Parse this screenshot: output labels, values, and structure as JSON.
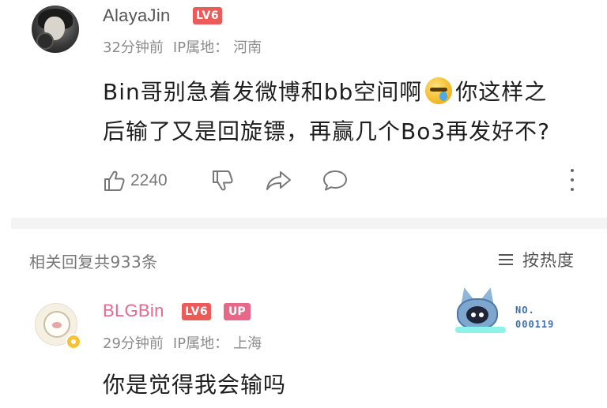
{
  "comment": {
    "username": "AlayaJin",
    "level": "LV6",
    "time": "32分钟前",
    "ip_label": "IP属地：",
    "ip_location": "河南",
    "text_line1_before_emoji": "Bin哥别急着发微博和bb空间啊",
    "text_line1_after_emoji": "你这样之",
    "text_line2": "后输了又是回旋镖，再赢几个Bo3再发好不?",
    "emoji": "facepalm-emoji",
    "like_count": "2240"
  },
  "replies_header": {
    "count_text": "相关回复共933条",
    "sort_label": "按热度"
  },
  "reply": {
    "username": "BLGBin",
    "level": "LV6",
    "up_badge": "UP",
    "time": "29分钟前",
    "ip_label": "IP属地：",
    "ip_location": "上海",
    "text": "你是觉得我会输吗",
    "fan_badge": {
      "label": "NO.",
      "number": "000119"
    }
  },
  "colors": {
    "level_badge": "#ec5a5a",
    "up_color": "#e8688c",
    "meta_text": "#8c8c8c",
    "icon_gray": "#777777"
  }
}
